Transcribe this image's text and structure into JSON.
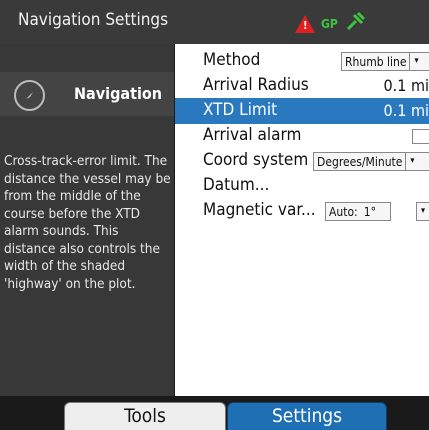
{
  "header": {
    "title": "Navigation Settings",
    "status": {
      "alarm_icon": "alarm-triangle-icon",
      "gps_label": "GP",
      "satellite_icon": "satellite-icon",
      "status_color": "#3ec43e",
      "alarm_color": "#e02020"
    }
  },
  "sidebar": {
    "section_label": "Navigation",
    "section_icon": "compass-icon",
    "help_text": "Cross-track-error limit. The distance the vessel may be from the middle of the course before the XTD alarm sounds. This distance also controls the width of the shaded 'highway' on the plot."
  },
  "settings": {
    "method": {
      "label": "Method",
      "value": "Rhumb line"
    },
    "arrival_radius": {
      "label": "Arrival Radius",
      "value": "0.1 mi"
    },
    "xtd_limit": {
      "label": "XTD Limit",
      "value": "0.1 mi"
    },
    "arrival_alarm": {
      "label": "Arrival alarm"
    },
    "coord_system": {
      "label": "Coord system",
      "value": "Degrees/Minute"
    },
    "datum": {
      "label": "Datum..."
    },
    "magnetic_variation": {
      "label": "Magnetic var...",
      "mode": "Auto:",
      "value": "1°"
    }
  },
  "tabs": {
    "tools": "Tools",
    "settings": "Settings"
  },
  "colors": {
    "selection": "#2a79bf",
    "active_tab": "#1f6fb4"
  }
}
